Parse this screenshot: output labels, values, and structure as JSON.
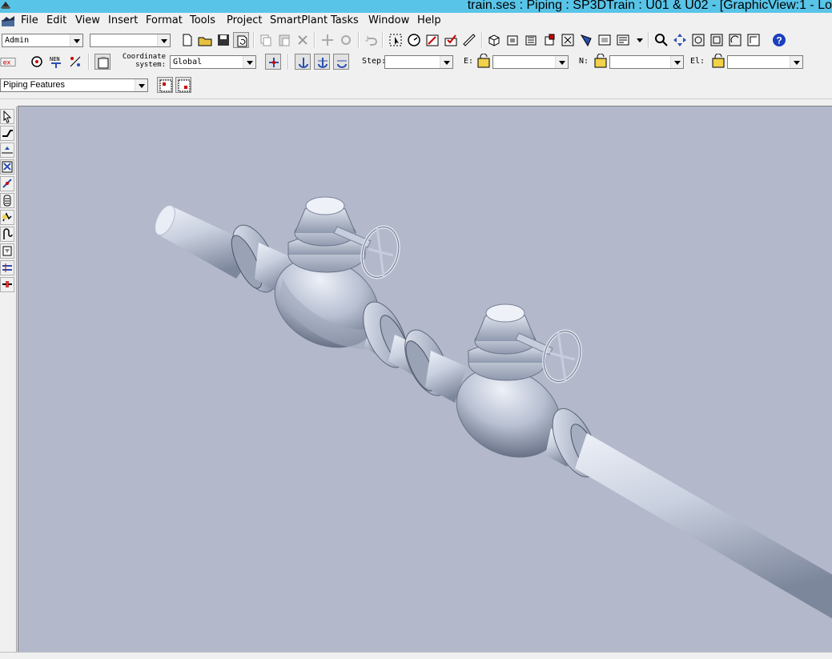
{
  "window": {
    "title": "train.ses : Piping : SP3DTrain : U01 & U02 - [GraphicView:1 - Lo"
  },
  "menu": {
    "items": [
      "File",
      "Edit",
      "View",
      "Insert",
      "Format",
      "Tools",
      "Project",
      "SmartPlant",
      "Tasks",
      "Window",
      "Help"
    ]
  },
  "toolbar1": {
    "permission_group": "Admin",
    "second_combo": ""
  },
  "toolbar2": {
    "coordinate_label_line1": "Coordinate",
    "coordinate_label_line2": "system:",
    "coordinate_system": "Global",
    "step_label": "Step:",
    "step_value": "",
    "e_label": "E:",
    "e_value": "",
    "n_label": "N:",
    "n_value": "",
    "el_label": "El:",
    "el_value": ""
  },
  "toolbar3": {
    "task_selector": "Piping Features"
  },
  "viewport": {
    "background": "#b3b9cb",
    "model_color": "#c7cedd"
  },
  "colors": {
    "titlebar": "#58c4e8",
    "chrome": "#f0f0f0",
    "help_blue": "#1a3fbf"
  }
}
